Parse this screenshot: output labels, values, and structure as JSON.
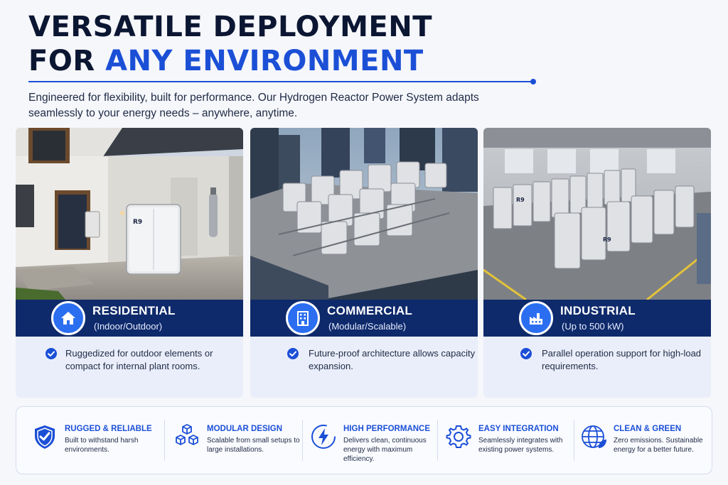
{
  "header": {
    "title_line1": "VERSATILE DEPLOYMENT",
    "title_line2_prefix": "FOR ",
    "title_line2_accent": "ANY ENVIRONMENT",
    "subtitle": "Engineered for flexibility, built for performance. Our Hydrogen Reactor Power System adapts seamlessly to your energy needs – anywhere, anytime."
  },
  "cards": [
    {
      "title": "RESIDENTIAL",
      "subtitle": "(Indoor/Outdoor)",
      "icon": "house-icon",
      "text": "Ruggedized for outdoor elements or compact for internal plant rooms."
    },
    {
      "title": "COMMERCIAL",
      "subtitle": "(Modular/Scalable)",
      "icon": "office-building-icon",
      "text": "Future-proof architecture allows capacity expansion."
    },
    {
      "title": "INDUSTRIAL",
      "subtitle": "(Up to 500 kW)",
      "icon": "factory-icon",
      "text": "Parallel operation support for high-load requirements."
    }
  ],
  "unit_badge": "R9",
  "features": [
    {
      "title": "RUGGED & RELIABLE",
      "desc": "Built to withstand harsh environments.",
      "icon": "shield-check-icon"
    },
    {
      "title": "MODULAR DESIGN",
      "desc": "Scalable from small setups to large installations.",
      "icon": "cubes-icon"
    },
    {
      "title": "HIGH PERFORMANCE",
      "desc": "Delivers clean, continuous energy with maximum efficiency.",
      "icon": "lightning-icon"
    },
    {
      "title": "EASY INTEGRATION",
      "desc": "Seamlessly integrates with existing power systems.",
      "icon": "gear-icon"
    },
    {
      "title": "CLEAN & GREEN",
      "desc": "Zero emissions. Sustainable energy for a better future.",
      "icon": "globe-leaf-icon"
    }
  ],
  "colors": {
    "accent": "#1b4fd6",
    "navy": "#0f2a6b",
    "dark": "#0b1633"
  }
}
